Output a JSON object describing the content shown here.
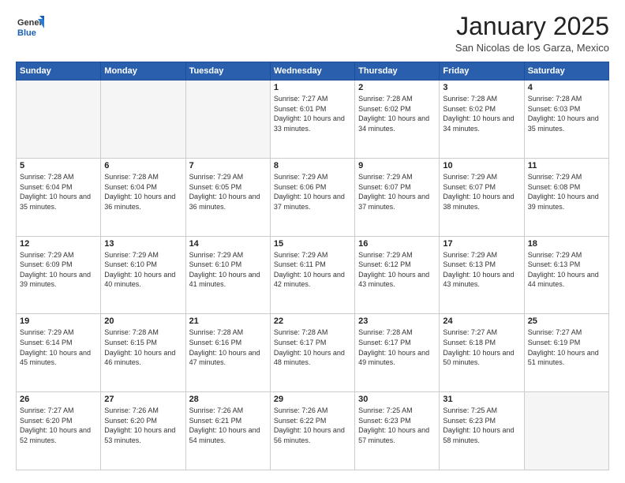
{
  "logo": {
    "general": "General",
    "blue": "Blue"
  },
  "header": {
    "month": "January 2025",
    "location": "San Nicolas de los Garza, Mexico"
  },
  "weekdays": [
    "Sunday",
    "Monday",
    "Tuesday",
    "Wednesday",
    "Thursday",
    "Friday",
    "Saturday"
  ],
  "weeks": [
    [
      {
        "day": "",
        "sunrise": "",
        "sunset": "",
        "daylight": ""
      },
      {
        "day": "",
        "sunrise": "",
        "sunset": "",
        "daylight": ""
      },
      {
        "day": "",
        "sunrise": "",
        "sunset": "",
        "daylight": ""
      },
      {
        "day": "1",
        "sunrise": "7:27 AM",
        "sunset": "6:01 PM",
        "daylight": "10 hours and 33 minutes."
      },
      {
        "day": "2",
        "sunrise": "7:28 AM",
        "sunset": "6:02 PM",
        "daylight": "10 hours and 34 minutes."
      },
      {
        "day": "3",
        "sunrise": "7:28 AM",
        "sunset": "6:02 PM",
        "daylight": "10 hours and 34 minutes."
      },
      {
        "day": "4",
        "sunrise": "7:28 AM",
        "sunset": "6:03 PM",
        "daylight": "10 hours and 35 minutes."
      }
    ],
    [
      {
        "day": "5",
        "sunrise": "7:28 AM",
        "sunset": "6:04 PM",
        "daylight": "10 hours and 35 minutes."
      },
      {
        "day": "6",
        "sunrise": "7:28 AM",
        "sunset": "6:04 PM",
        "daylight": "10 hours and 36 minutes."
      },
      {
        "day": "7",
        "sunrise": "7:29 AM",
        "sunset": "6:05 PM",
        "daylight": "10 hours and 36 minutes."
      },
      {
        "day": "8",
        "sunrise": "7:29 AM",
        "sunset": "6:06 PM",
        "daylight": "10 hours and 37 minutes."
      },
      {
        "day": "9",
        "sunrise": "7:29 AM",
        "sunset": "6:07 PM",
        "daylight": "10 hours and 37 minutes."
      },
      {
        "day": "10",
        "sunrise": "7:29 AM",
        "sunset": "6:07 PM",
        "daylight": "10 hours and 38 minutes."
      },
      {
        "day": "11",
        "sunrise": "7:29 AM",
        "sunset": "6:08 PM",
        "daylight": "10 hours and 39 minutes."
      }
    ],
    [
      {
        "day": "12",
        "sunrise": "7:29 AM",
        "sunset": "6:09 PM",
        "daylight": "10 hours and 39 minutes."
      },
      {
        "day": "13",
        "sunrise": "7:29 AM",
        "sunset": "6:10 PM",
        "daylight": "10 hours and 40 minutes."
      },
      {
        "day": "14",
        "sunrise": "7:29 AM",
        "sunset": "6:10 PM",
        "daylight": "10 hours and 41 minutes."
      },
      {
        "day": "15",
        "sunrise": "7:29 AM",
        "sunset": "6:11 PM",
        "daylight": "10 hours and 42 minutes."
      },
      {
        "day": "16",
        "sunrise": "7:29 AM",
        "sunset": "6:12 PM",
        "daylight": "10 hours and 43 minutes."
      },
      {
        "day": "17",
        "sunrise": "7:29 AM",
        "sunset": "6:13 PM",
        "daylight": "10 hours and 43 minutes."
      },
      {
        "day": "18",
        "sunrise": "7:29 AM",
        "sunset": "6:13 PM",
        "daylight": "10 hours and 44 minutes."
      }
    ],
    [
      {
        "day": "19",
        "sunrise": "7:29 AM",
        "sunset": "6:14 PM",
        "daylight": "10 hours and 45 minutes."
      },
      {
        "day": "20",
        "sunrise": "7:28 AM",
        "sunset": "6:15 PM",
        "daylight": "10 hours and 46 minutes."
      },
      {
        "day": "21",
        "sunrise": "7:28 AM",
        "sunset": "6:16 PM",
        "daylight": "10 hours and 47 minutes."
      },
      {
        "day": "22",
        "sunrise": "7:28 AM",
        "sunset": "6:17 PM",
        "daylight": "10 hours and 48 minutes."
      },
      {
        "day": "23",
        "sunrise": "7:28 AM",
        "sunset": "6:17 PM",
        "daylight": "10 hours and 49 minutes."
      },
      {
        "day": "24",
        "sunrise": "7:27 AM",
        "sunset": "6:18 PM",
        "daylight": "10 hours and 50 minutes."
      },
      {
        "day": "25",
        "sunrise": "7:27 AM",
        "sunset": "6:19 PM",
        "daylight": "10 hours and 51 minutes."
      }
    ],
    [
      {
        "day": "26",
        "sunrise": "7:27 AM",
        "sunset": "6:20 PM",
        "daylight": "10 hours and 52 minutes."
      },
      {
        "day": "27",
        "sunrise": "7:26 AM",
        "sunset": "6:20 PM",
        "daylight": "10 hours and 53 minutes."
      },
      {
        "day": "28",
        "sunrise": "7:26 AM",
        "sunset": "6:21 PM",
        "daylight": "10 hours and 54 minutes."
      },
      {
        "day": "29",
        "sunrise": "7:26 AM",
        "sunset": "6:22 PM",
        "daylight": "10 hours and 56 minutes."
      },
      {
        "day": "30",
        "sunrise": "7:25 AM",
        "sunset": "6:23 PM",
        "daylight": "10 hours and 57 minutes."
      },
      {
        "day": "31",
        "sunrise": "7:25 AM",
        "sunset": "6:23 PM",
        "daylight": "10 hours and 58 minutes."
      },
      {
        "day": "",
        "sunrise": "",
        "sunset": "",
        "daylight": ""
      }
    ]
  ],
  "labels": {
    "sunrise": "Sunrise:",
    "sunset": "Sunset:",
    "daylight": "Daylight:"
  }
}
